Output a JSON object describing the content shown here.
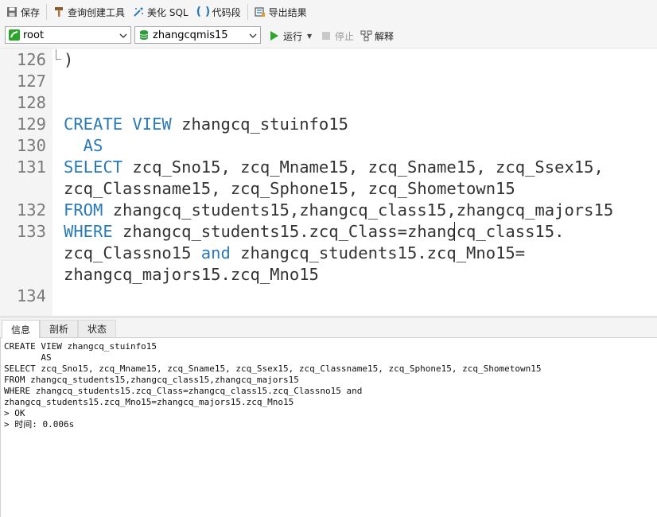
{
  "toolbar": {
    "save": "保存",
    "query_builder": "查询创建工具",
    "beautify": "美化 SQL",
    "snippet": "代码段",
    "export": "导出结果"
  },
  "selectors": {
    "connection": "root",
    "database": "zhangcqmis15"
  },
  "actions": {
    "run": "运行",
    "stop": "停止",
    "explain": "解释"
  },
  "editor": {
    "line_numbers": [
      "126",
      "127",
      "128",
      "129",
      "130",
      "131",
      "132",
      "133",
      "134"
    ],
    "lines": {
      "l126": ")",
      "l129_kw": "CREATE VIEW",
      "l129_rest": " zhangcq_stuinfo15",
      "l130_kw": "  AS",
      "l131_kw": "SELECT",
      "l131_rest": " zcq_Sno15, zcq_Mname15, zcq_Sname15, zcq_Ssex15,",
      "l131_wrap": "zcq_Classname15, zcq_Sphone15, zcq_Shometown15",
      "l132_kw": "FROM",
      "l132_rest": " zhangcq_students15,zhangcq_class15,zhangcq_majors15",
      "l133_kw": "WHERE",
      "l133_rest": " zhangcq_students15.zcq_Class=zhangcq_class15.",
      "l133_wrap1_a": "zcq_Classno15 ",
      "l133_wrap1_kw": "and",
      "l133_wrap1_b": " zhangcq_students15.zcq_Mno15=",
      "l133_wrap2": "zhangcq_majors15.zcq_Mno15"
    }
  },
  "tabs": [
    "信息",
    "剖析",
    "状态"
  ],
  "output": [
    "CREATE VIEW zhangcq_stuinfo15",
    "       AS",
    "SELECT zcq_Sno15, zcq_Mname15, zcq_Sname15, zcq_Ssex15, zcq_Classname15, zcq_Sphone15, zcq_Shometown15",
    "FROM zhangcq_students15,zhangcq_class15,zhangcq_majors15",
    "WHERE zhangcq_students15.zcq_Class=zhangcq_class15.zcq_Classno15 and",
    "zhangcq_students15.zcq_Mno15=zhangcq_majors15.zcq_Mno15",
    "> OK",
    "> 时间: 0.006s"
  ],
  "colors": {
    "keyword": "#2a7ab8",
    "run_green": "#2aa62a",
    "db_green": "#2f9a3c"
  }
}
